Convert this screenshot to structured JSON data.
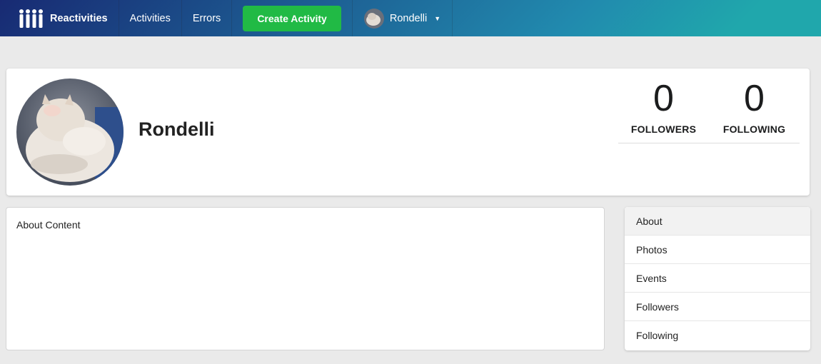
{
  "navbar": {
    "brand": "Reactivities",
    "links": [
      "Activities",
      "Errors"
    ],
    "create_button": "Create Activity",
    "user_name": "Rondelli"
  },
  "profile": {
    "display_name": "Rondelli",
    "stats": [
      {
        "value": "0",
        "label": "FOLLOWERS"
      },
      {
        "value": "0",
        "label": "FOLLOWING"
      }
    ]
  },
  "content": {
    "text": "About Content"
  },
  "side_menu": {
    "items": [
      "About",
      "Photos",
      "Events",
      "Followers",
      "Following"
    ],
    "active": "About"
  },
  "colors": {
    "create_button": "#21ba45",
    "navbar_start": "#182a73",
    "navbar_end": "#20a7ac"
  }
}
